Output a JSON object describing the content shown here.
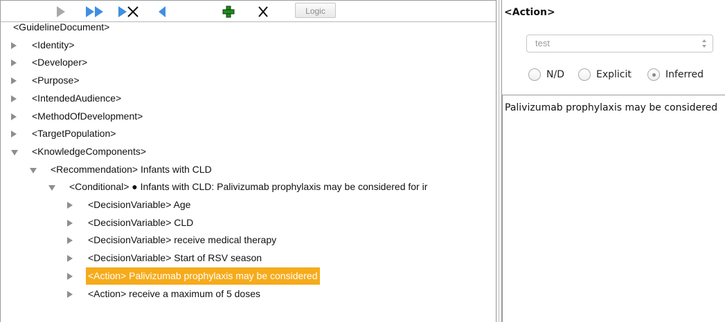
{
  "toolbar": {
    "logic_label": "Logic",
    "colors": {
      "arrow_gray": "#9a9a9a",
      "arrow_blue": "#3f8fe0",
      "add_green": "#1f8a1f"
    }
  },
  "tree": {
    "rows": [
      {
        "label": "<GuidelineDocument>",
        "depth": 0,
        "state": "none"
      },
      {
        "label": "<Identity>",
        "depth": 1,
        "state": "closed"
      },
      {
        "label": "<Developer>",
        "depth": 1,
        "state": "closed"
      },
      {
        "label": "<Purpose>",
        "depth": 1,
        "state": "closed"
      },
      {
        "label": "<IntendedAudience>",
        "depth": 1,
        "state": "closed"
      },
      {
        "label": "<MethodOfDevelopment>",
        "depth": 1,
        "state": "closed"
      },
      {
        "label": "<TargetPopulation>",
        "depth": 1,
        "state": "closed"
      },
      {
        "label": "<KnowledgeComponents>",
        "depth": 1,
        "state": "open"
      },
      {
        "label": "<Recommendation> Infants with CLD",
        "depth": 2,
        "state": "open"
      },
      {
        "label": "<Conditional> ● Infants with CLD: Palivizumab prophylaxis may be considered for ir",
        "depth": 3,
        "state": "open"
      },
      {
        "label": "<DecisionVariable> Age",
        "depth": 4,
        "state": "closed"
      },
      {
        "label": "<DecisionVariable> CLD",
        "depth": 4,
        "state": "closed"
      },
      {
        "label": "<DecisionVariable> receive medical therapy",
        "depth": 4,
        "state": "closed"
      },
      {
        "label": "<DecisionVariable> Start of RSV season",
        "depth": 4,
        "state": "closed"
      },
      {
        "label": "<Action> Palivizumab prophylaxis may be considered",
        "depth": 4,
        "state": "closed",
        "selected": true
      },
      {
        "label": "<Action> receive a maximum of 5 doses",
        "depth": 4,
        "state": "closed"
      }
    ],
    "selection_color": "#f6ab1c"
  },
  "right": {
    "title": "<Action>",
    "select_value": "test",
    "radios": [
      {
        "label": "N/D",
        "checked": false
      },
      {
        "label": "Explicit",
        "checked": false
      },
      {
        "label": "Inferred",
        "checked": true
      }
    ],
    "text": "Palivizumab prophylaxis may be considered"
  }
}
